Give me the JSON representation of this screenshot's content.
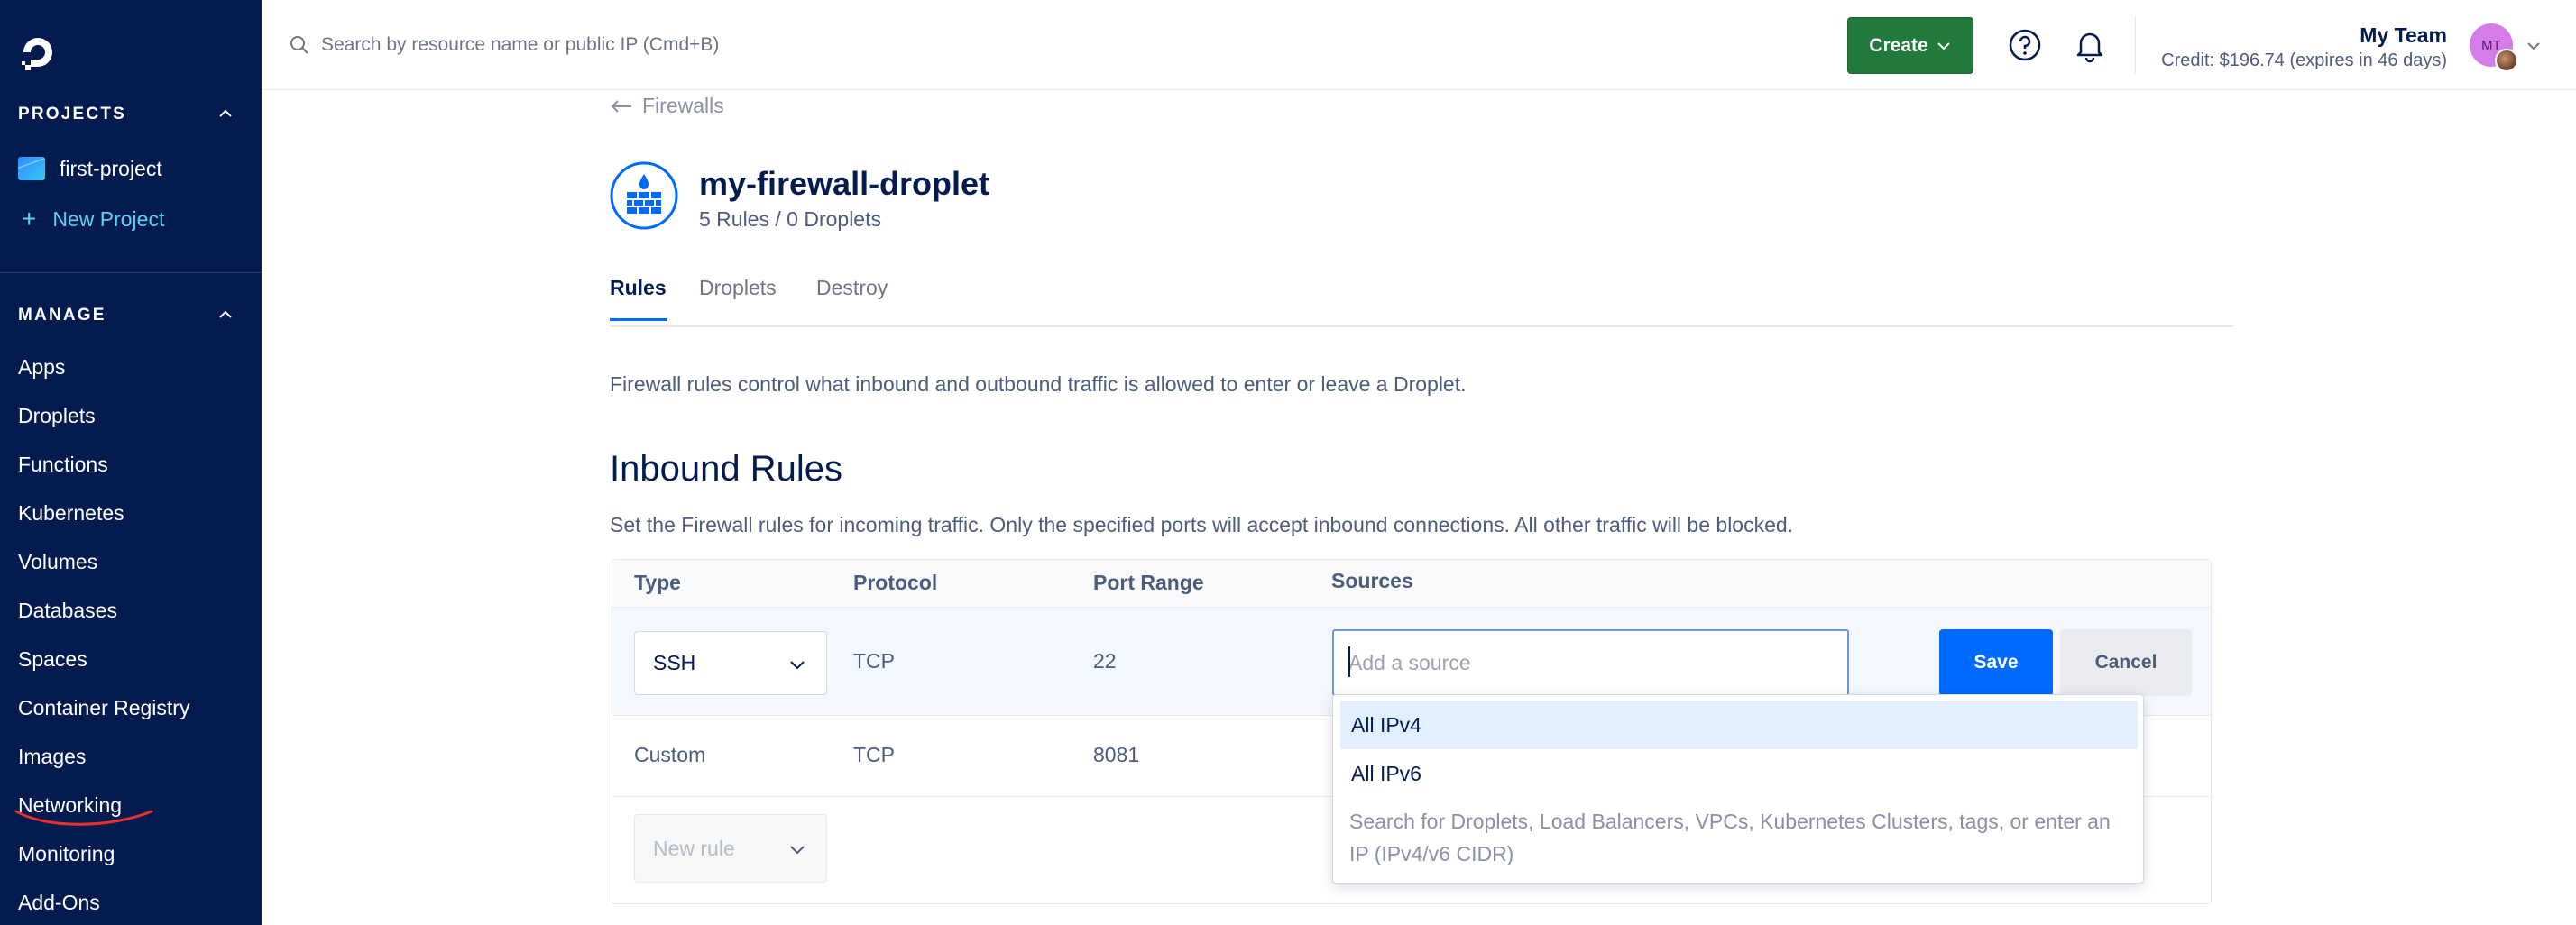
{
  "sidebar": {
    "projects_title": "PROJECTS",
    "projects": [
      {
        "label": "first-project"
      }
    ],
    "new_project_label": "New Project",
    "manage_title": "MANAGE",
    "nav": [
      {
        "label": "Apps"
      },
      {
        "label": "Droplets"
      },
      {
        "label": "Functions"
      },
      {
        "label": "Kubernetes"
      },
      {
        "label": "Volumes"
      },
      {
        "label": "Databases"
      },
      {
        "label": "Spaces"
      },
      {
        "label": "Container Registry"
      },
      {
        "label": "Images"
      },
      {
        "label": "Networking"
      },
      {
        "label": "Monitoring"
      },
      {
        "label": "Add-Ons"
      }
    ],
    "colors": {
      "background": "#031b4e",
      "link": "#5fd0f5",
      "annotation": "#e8312a"
    }
  },
  "header": {
    "search_placeholder": "Search by resource name or public IP (Cmd+B)",
    "create_label": "Create",
    "team_name": "My Team",
    "credit_text": "Credit: $196.74 (expires in 46 days)",
    "avatar_initials": "MT",
    "colors": {
      "create": "#217a3c",
      "avatar": "#d57ce8"
    }
  },
  "page": {
    "back_label": "Firewalls",
    "title": "my-firewall-droplet",
    "subtitle": "5 Rules / 0 Droplets",
    "tabs": [
      {
        "label": "Rules",
        "active": true
      },
      {
        "label": "Droplets",
        "active": false
      },
      {
        "label": "Destroy",
        "active": false
      }
    ],
    "description": "Firewall rules control what inbound and outbound traffic is allowed to enter or leave a Droplet.",
    "inbound": {
      "title": "Inbound Rules",
      "description": "Set the Firewall rules for incoming traffic. Only the specified ports will accept inbound connections. All other traffic will be blocked.",
      "columns": [
        "Type",
        "Protocol",
        "Port Range",
        "Sources"
      ],
      "editing_row": {
        "type": "SSH",
        "protocol": "TCP",
        "port_range": "22",
        "source_placeholder": "Add a source",
        "save_label": "Save",
        "cancel_label": "Cancel"
      },
      "rows": [
        {
          "type": "Custom",
          "protocol": "TCP",
          "port_range": "8081"
        }
      ],
      "new_rule_placeholder": "New rule"
    },
    "source_dropdown": {
      "options": [
        {
          "label": "All IPv4",
          "highlighted": true
        },
        {
          "label": "All IPv6",
          "highlighted": false
        }
      ],
      "hint": "Search for Droplets, Load Balancers, VPCs, Kubernetes Clusters, tags, or enter an IP (IPv4/v6 CIDR)"
    },
    "colors": {
      "primary": "#0069ff",
      "text": "#031b4e"
    }
  }
}
